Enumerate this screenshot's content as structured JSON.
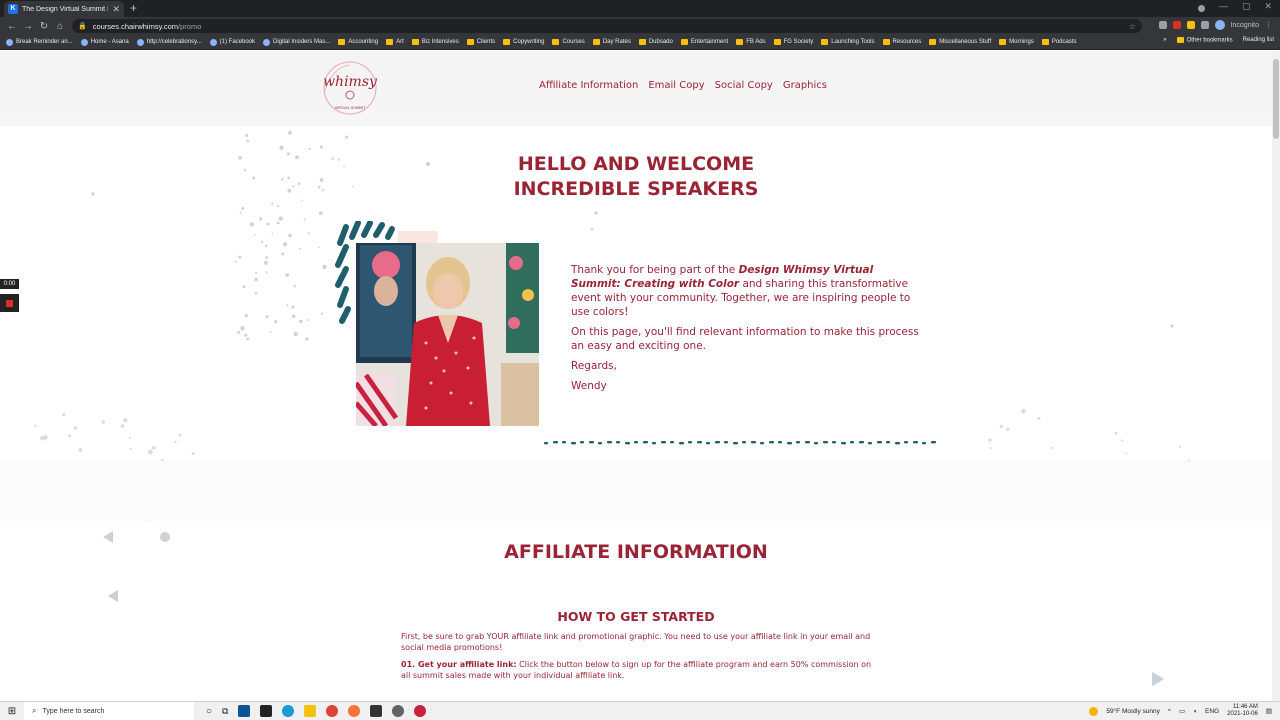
{
  "browser": {
    "tab_title": "The Design Virtual Summit Prom...",
    "url_host": "courses.chairwhimsy.com",
    "url_path": "/promo",
    "profile_label": "Incognito",
    "bookmarks": [
      {
        "label": "Break Reminder an...",
        "icon": "globe"
      },
      {
        "label": "Home - Asana",
        "icon": "globe"
      },
      {
        "label": "http://celebrationsy...",
        "icon": "globe"
      },
      {
        "label": "(1) Facebook",
        "icon": "globe"
      },
      {
        "label": "Digital Insiders Mas...",
        "icon": "globe"
      },
      {
        "label": "Accounting",
        "icon": "folder"
      },
      {
        "label": "Art",
        "icon": "folder"
      },
      {
        "label": "Biz Intensives",
        "icon": "folder"
      },
      {
        "label": "Clients",
        "icon": "folder"
      },
      {
        "label": "Copywriting",
        "icon": "folder"
      },
      {
        "label": "Courses",
        "icon": "folder"
      },
      {
        "label": "Day Rates",
        "icon": "folder"
      },
      {
        "label": "Dubsado",
        "icon": "folder"
      },
      {
        "label": "Entertainment",
        "icon": "folder"
      },
      {
        "label": "FB Ads",
        "icon": "folder"
      },
      {
        "label": "FG Society",
        "icon": "folder"
      },
      {
        "label": "Launching Tools",
        "icon": "folder"
      },
      {
        "label": "Resources",
        "icon": "folder"
      },
      {
        "label": "Miscellaneous Stuff",
        "icon": "folder"
      },
      {
        "label": "Mornings",
        "icon": "folder"
      },
      {
        "label": "Podcasts",
        "icon": "folder"
      }
    ],
    "other_bookmarks": "Other bookmarks",
    "reading_list": "Reading list",
    "more_chevron": "»"
  },
  "site": {
    "logo_text": "whimsy",
    "logo_subtext": "VIRTUAL SUMMIT",
    "nav": [
      "Affiliate Information",
      "Email Copy",
      "Social Copy",
      "Graphics"
    ],
    "welcome_line1": "HELLO AND WELCOME",
    "welcome_line2": "INCREDIBLE SPEAKERS",
    "intro_p1_pre": "Thank you for being part of the ",
    "intro_p1_bold": "Design Whimsy Virtual Summit: Creating with Color",
    "intro_p1_post": " and sharing this transformative event with your community. Together, we are inspiring people to use colors!",
    "intro_p2": "On this page, you'll find relevant information to make this process an easy and exciting one.",
    "intro_p3": "Regards,",
    "intro_p4": "Wendy",
    "affiliate_title": "AFFILIATE INFORMATION",
    "how_title": "HOW TO GET STARTED",
    "how_p1": "First, be sure to grab YOUR affiliate link and promotional graphic. You need to use your affiliate link in your email and social media promotions!",
    "how_p2_bold": "01. Get your affiliate link:",
    "how_p2_rest": " Click the button below to sign up for the affiliate program and earn 50% commission on all summit sales made with your individual affiliate link."
  },
  "recorder": {
    "timer": "0:00"
  },
  "taskbar": {
    "search_placeholder": "Type here to search",
    "weather": "59°F  Mostly sunny",
    "lang": "ENG",
    "time": "11:46 AM",
    "date": "2021-10-06"
  },
  "colors": {
    "brand": "#9b2336",
    "teal": "#1f5f6b"
  }
}
